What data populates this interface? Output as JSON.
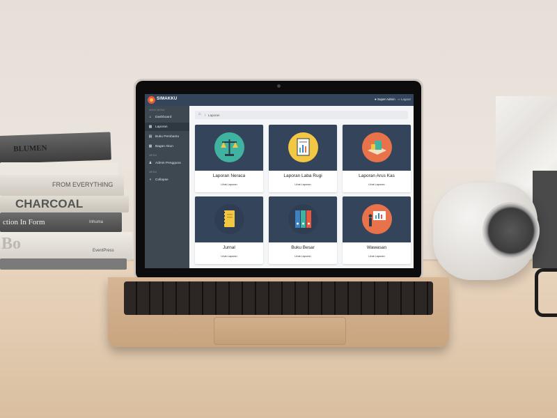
{
  "app": {
    "brand": "SIMAKKU",
    "user_label": "Super Admin",
    "logout_label": "Logout"
  },
  "sidebar": {
    "sections": [
      "MAIN MENU",
      "MENU",
      "MENU"
    ],
    "items": [
      {
        "label": "Dashboard",
        "icon": "home-icon"
      },
      {
        "label": "Laporan",
        "icon": "folder-icon"
      },
      {
        "label": "Buku Pembantu",
        "icon": "book-icon"
      },
      {
        "label": "Bagan Akun",
        "icon": "chart-icon"
      },
      {
        "label": "Admin Pengguna",
        "icon": "users-icon"
      },
      {
        "label": "Collapse",
        "icon": "double-chevron-left-icon"
      }
    ]
  },
  "breadcrumb": {
    "current": "Laporan",
    "separator": "/"
  },
  "cards": [
    {
      "title": "Laporan Neraca",
      "link": "Lihat Laporan",
      "icon": "scale-icon",
      "color": "#3fb3a0"
    },
    {
      "title": "Laporan Laba Rugi",
      "link": "Lihat Laporan",
      "icon": "report-chart-icon",
      "color": "#f2c744"
    },
    {
      "title": "Laporan Arus Kas",
      "link": "Lihat Laporan",
      "icon": "cashflow-icon",
      "color": "#e8734a"
    },
    {
      "title": "Jurnal",
      "link": "Lihat Laporan",
      "icon": "notebook-icon",
      "color": "#34455b"
    },
    {
      "title": "Buku Besar",
      "link": "Lihat Laporan",
      "icon": "binders-icon",
      "color": "#34455b"
    },
    {
      "title": "Wawasan",
      "link": "Lihat Laporan",
      "icon": "presentation-icon",
      "color": "#e8734a"
    }
  ],
  "scene_text": {
    "book1": "BLUMEN",
    "book2": "FROM EVERYTHING",
    "book3": "CHARCOAL",
    "book4": "ction In Form",
    "book4b": "Inhuma",
    "book5": "Bo",
    "book5b": "EventPress"
  }
}
